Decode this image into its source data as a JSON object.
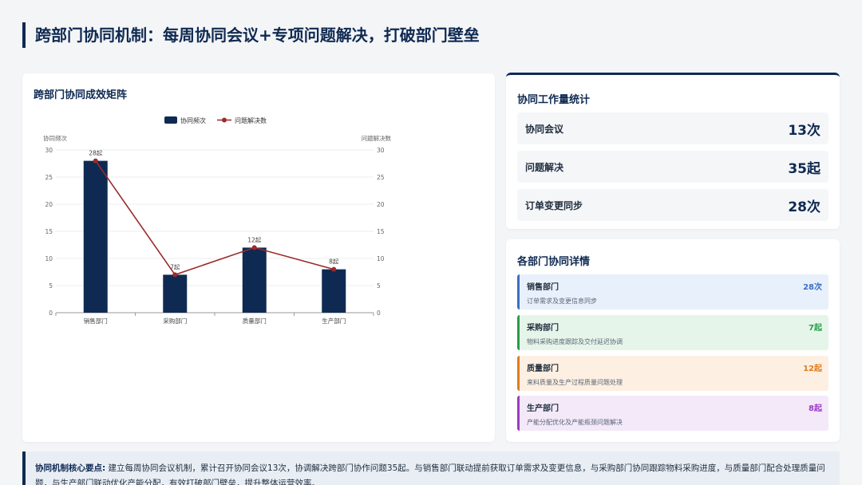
{
  "page": {
    "title": "跨部门协同机制：每周协同会议+专项问题解决，打破部门壁垒"
  },
  "chart_card": {
    "title": "跨部门协同成效矩阵"
  },
  "chart_data": {
    "type": "bar",
    "categories": [
      "销售部门",
      "采购部门",
      "质量部门",
      "生产部门"
    ],
    "series": [
      {
        "name": "协同频次",
        "type": "bar",
        "values": [
          28,
          7,
          12,
          8
        ],
        "color": "#0f2a52"
      },
      {
        "name": "问题解决数",
        "type": "line",
        "values": [
          28,
          7,
          12,
          8
        ],
        "color": "#9b2a2a"
      }
    ],
    "data_labels": [
      "28起",
      "7起",
      "12起",
      "8起"
    ],
    "ylabel": "协同频次",
    "y2label": "问题解决数",
    "ylim": [
      0,
      30
    ],
    "y2lim": [
      0,
      30
    ],
    "yticks": [
      "0",
      "5",
      "10",
      "15",
      "20",
      "25",
      "30"
    ],
    "legend": "top-center",
    "grid": true
  },
  "stats": {
    "title": "协同工作量统计",
    "items": [
      {
        "label": "协同会议",
        "value": "13次"
      },
      {
        "label": "问题解决",
        "value": "35起"
      },
      {
        "label": "订单变更同步",
        "value": "28次"
      }
    ]
  },
  "details": {
    "title": "各部门协同详情",
    "items": [
      {
        "name": "销售部门",
        "count": "28次",
        "desc": "订单需求及变更信息同步",
        "color": "#3b6fc4",
        "bg": "#e8f0fb"
      },
      {
        "name": "采购部门",
        "count": "7起",
        "desc": "物料采购进度跟踪及交付延迟协调",
        "color": "#2a9d4a",
        "bg": "#e6f5ea"
      },
      {
        "name": "质量部门",
        "count": "12起",
        "desc": "来料质量及生产过程质量问题处理",
        "color": "#e07b1f",
        "bg": "#fdf0e2"
      },
      {
        "name": "生产部门",
        "count": "8起",
        "desc": "产能分配优化及产能瓶颈问题解决",
        "color": "#9b3bc4",
        "bg": "#f3e9f9"
      }
    ]
  },
  "summary": {
    "label": "协同机制核心要点:",
    "text": "建立每周协同会议机制，累计召开协同会议13次，协调解决跨部门协作问题35起。与销售部门联动提前获取订单需求及变更信息，与采购部门协同跟踪物料采购进度，与质量部门配合处理质量问题，与生产部门联动优化产能分配，有效打破部门壁垒，提升整体运营效率。"
  }
}
